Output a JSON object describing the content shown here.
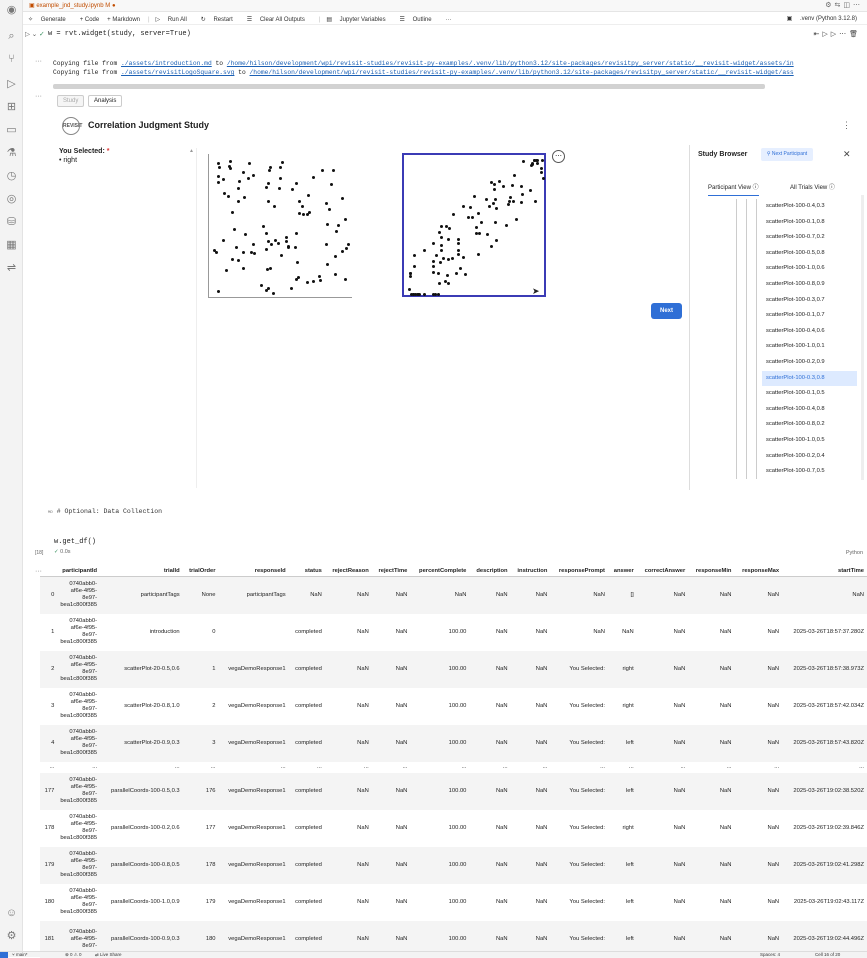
{
  "editor_tab": {
    "file": "example_jnd_study.ipynb",
    "modified": "M"
  },
  "toolbar": {
    "generate": "Generate",
    "code": "+ Code",
    "markdown": "+ Markdown",
    "run_all": "Run All",
    "restart": "Restart",
    "clear_outputs": "Clear All Outputs",
    "jupyter_vars": "Jupyter Variables",
    "outline": "Outline",
    "more": "···",
    "kernel": ".venv (Python 3.12.8)"
  },
  "cell1": {
    "code": "w = rvt.widget(study, server=True)",
    "out1_pre": "Copying file from ",
    "out1_src": "./assets/introduction.md",
    "out1_mid": " to ",
    "out1_dst": "/home/hilson/development/wpi/revisit-studies/revisit-py-examples/.venv/lib/python3.12/site-packages/revisitpy_server/static/__revisit-widget/assets/in",
    "out2_pre": "Copying file from ",
    "out2_src": "./assets/revisitLogoSquare.svg",
    "out2_mid": " to ",
    "out2_dst": "/home/hilson/development/wpi/revisit-studies/revisit-py-examples/.venv/lib/python3.12/site-packages/revisitpy_server/static/__revisit-widget/ass"
  },
  "widget": {
    "tab_study": "Study",
    "tab_analysis": "Analysis",
    "title": "Correlation Judgment Study",
    "logo": "REVISIT",
    "selected_label": "You Selected:",
    "required": "*",
    "selected_value": "right",
    "next": "Next",
    "browser": {
      "title": "Study Browser",
      "next_participant": "Next Participant",
      "participant_view": "Participant View",
      "all_trials": "All Trials View",
      "items": [
        "scatterPlot-100-0.4,0.3",
        "scatterPlot-100-0.1,0.8",
        "scatterPlot-100-0.7,0.2",
        "scatterPlot-100-0.5,0.8",
        "scatterPlot-100-1.0,0.6",
        "scatterPlot-100-0.8,0.9",
        "scatterPlot-100-0.3,0.7",
        "scatterPlot-100-0.1,0.7",
        "scatterPlot-100-0.4,0.6",
        "scatterPlot-100-1.0,0.1",
        "scatterPlot-100-0.2,0.9",
        "scatterPlot-100-0.3,0.8",
        "scatterPlot-100-0.1,0.5",
        "scatterPlot-100-0.4,0.8",
        "scatterPlot-100-0.8,0.2",
        "scatterPlot-100-1.0,0.5",
        "scatterPlot-100-0.2,0.4",
        "scatterPlot-100-0.7,0.5"
      ],
      "active_index": 11
    }
  },
  "markdown_cell": "# Optional: Data Collection",
  "cell3": {
    "code": "w.get_df()",
    "exec_count": "[18]",
    "time": "0.0s",
    "lang": "Python"
  },
  "table": {
    "columns": [
      "",
      "participantId",
      "trialId",
      "trialOrder",
      "responseId",
      "status",
      "rejectReason",
      "rejectTime",
      "percentComplete",
      "description",
      "instruction",
      "responsePrompt",
      "answer",
      "correctAnswer",
      "responseMin",
      "responseMax",
      "startTime"
    ],
    "rows": [
      [
        "0",
        "0740abb0-af6e-4f95-8e97-bea1c800f385",
        "participantTags",
        "None",
        "participantTags",
        "NaN",
        "NaN",
        "NaN",
        "NaN",
        "NaN",
        "NaN",
        "NaN",
        "[]",
        "NaN",
        "NaN",
        "NaN",
        "NaN"
      ],
      [
        "1",
        "0740abb0-af6e-4f95-8e97-bea1c800f385",
        "introduction",
        "0",
        "",
        "completed",
        "NaN",
        "NaN",
        "100.00",
        "NaN",
        "NaN",
        "NaN",
        "NaN",
        "NaN",
        "NaN",
        "NaN",
        "2025-03-26T18:57:37.280Z"
      ],
      [
        "2",
        "0740abb0-af6e-4f95-8e97-bea1c800f385",
        "scatterPlot-20-0.5,0.6",
        "1",
        "vegaDemoResponse1",
        "completed",
        "NaN",
        "NaN",
        "100.00",
        "NaN",
        "NaN",
        "You Selected:",
        "right",
        "NaN",
        "NaN",
        "NaN",
        "2025-03-26T18:57:38.973Z"
      ],
      [
        "3",
        "0740abb0-af6e-4f95-8e97-bea1c800f385",
        "scatterPlot-20-0.8,1.0",
        "2",
        "vegaDemoResponse1",
        "completed",
        "NaN",
        "NaN",
        "100.00",
        "NaN",
        "NaN",
        "You Selected:",
        "right",
        "NaN",
        "NaN",
        "NaN",
        "2025-03-26T18:57:42.034Z"
      ],
      [
        "4",
        "0740abb0-af6e-4f95-8e97-bea1c800f385",
        "scatterPlot-20-0.9,0.3",
        "3",
        "vegaDemoResponse1",
        "completed",
        "NaN",
        "NaN",
        "100.00",
        "NaN",
        "NaN",
        "You Selected:",
        "left",
        "NaN",
        "NaN",
        "NaN",
        "2025-03-26T18:57:43.820Z"
      ],
      [
        "...",
        "...",
        "...",
        "...",
        "...",
        "...",
        "...",
        "...",
        "...",
        "...",
        "...",
        "...",
        "...",
        "...",
        "...",
        "...",
        "..."
      ],
      [
        "177",
        "0740abb0-af6e-4f95-8e97-bea1c800f385",
        "parallelCoords-100-0.5,0.3",
        "176",
        "vegaDemoResponse1",
        "completed",
        "NaN",
        "NaN",
        "100.00",
        "NaN",
        "NaN",
        "You Selected:",
        "left",
        "NaN",
        "NaN",
        "NaN",
        "2025-03-26T19:02:38.520Z"
      ],
      [
        "178",
        "0740abb0-af6e-4f95-8e97-bea1c800f385",
        "parallelCoords-100-0.2,0.6",
        "177",
        "vegaDemoResponse1",
        "completed",
        "NaN",
        "NaN",
        "100.00",
        "NaN",
        "NaN",
        "You Selected:",
        "right",
        "NaN",
        "NaN",
        "NaN",
        "2025-03-26T19:02:39.846Z"
      ],
      [
        "179",
        "0740abb0-af6e-4f95-8e97-bea1c800f385",
        "parallelCoords-100-0.8,0.5",
        "178",
        "vegaDemoResponse1",
        "completed",
        "NaN",
        "NaN",
        "100.00",
        "NaN",
        "NaN",
        "You Selected:",
        "left",
        "NaN",
        "NaN",
        "NaN",
        "2025-03-26T19:02:41.298Z"
      ],
      [
        "180",
        "0740abb0-af6e-4f95-8e97-bea1c800f385",
        "parallelCoords-100-1.0,0.9",
        "179",
        "vegaDemoResponse1",
        "completed",
        "NaN",
        "NaN",
        "100.00",
        "NaN",
        "NaN",
        "You Selected:",
        "left",
        "NaN",
        "NaN",
        "NaN",
        "2025-03-26T19:02:43.117Z"
      ],
      [
        "181",
        "0740abb0-af6e-4f95-8e97-",
        "parallelCoords-100-0.9,0.3",
        "180",
        "vegaDemoResponse1",
        "completed",
        "NaN",
        "NaN",
        "100.00",
        "NaN",
        "NaN",
        "You Selected:",
        "left",
        "NaN",
        "NaN",
        "NaN",
        "2025-03-26T19:02:44.496Z"
      ]
    ],
    "trailing": "26T1"
  },
  "statusbar": {
    "branch": "main*",
    "problems": "⊗ 0 ⚠ 0",
    "live_share": "Live Share",
    "spaces": "Spaces: 4",
    "cell": "Cell 16 of 20"
  }
}
